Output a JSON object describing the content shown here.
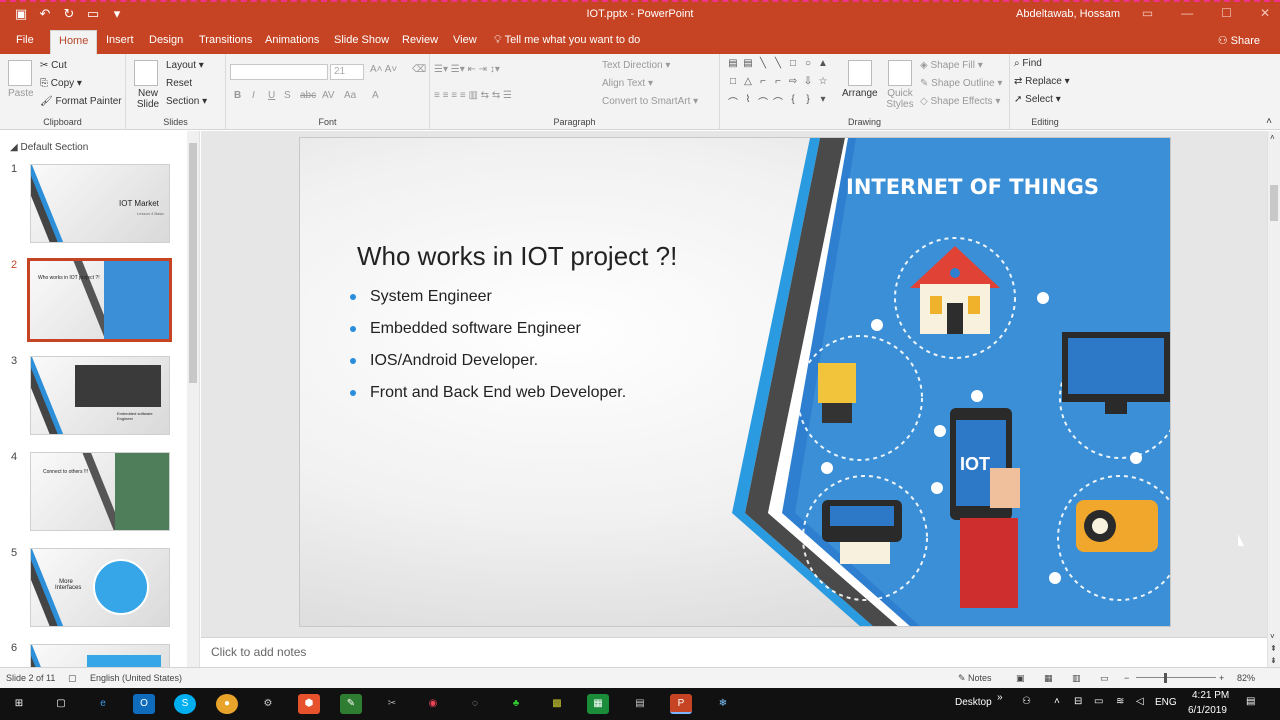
{
  "window": {
    "title": "IOT.pptx  -  PowerPoint",
    "user": "Abdeltawab, Hossam",
    "qat": [
      "save-icon",
      "undo-icon",
      "redo-icon",
      "start-from-beginning-icon",
      "customize-icon"
    ]
  },
  "tabs": [
    "File",
    "Home",
    "Insert",
    "Design",
    "Transitions",
    "Animations",
    "Slide Show",
    "Review",
    "View"
  ],
  "active_tab": "Home",
  "tell_me": "Tell me what you want to do",
  "share": "Share",
  "ribbon": {
    "clipboard": {
      "paste": "Paste",
      "cut": "Cut",
      "copy": "Copy",
      "format_painter": "Format Painter",
      "label": "Clipboard"
    },
    "slides": {
      "new_slide": "New Slide",
      "layout": "Layout",
      "reset": "Reset",
      "section": "Section",
      "label": "Slides"
    },
    "font": {
      "size": "21",
      "label": "Font",
      "buttons": [
        "B",
        "I",
        "U",
        "S",
        "abc",
        "AV",
        "Aa",
        "A"
      ]
    },
    "paragraph": {
      "text_direction": "Text Direction",
      "align_text": "Align Text",
      "convert_smartart": "Convert to SmartArt",
      "label": "Paragraph"
    },
    "drawing": {
      "arrange": "Arrange",
      "quick_styles": "Quick Styles",
      "shape_fill": "Shape Fill",
      "shape_outline": "Shape Outline",
      "shape_effects": "Shape Effects",
      "label": "Drawing"
    },
    "editing": {
      "find": "Find",
      "replace": "Replace",
      "select": "Select",
      "label": "Editing"
    }
  },
  "thumbnails": {
    "section": "Default Section",
    "items": [
      {
        "num": "1",
        "title": "IOT Market",
        "subtitle": "Lesson 4 Basic"
      },
      {
        "num": "2",
        "title": "Who works in IOT project ?!"
      },
      {
        "num": "3",
        "title": "Embedded software Engineer"
      },
      {
        "num": "4",
        "title": "Connect to others !!!"
      },
      {
        "num": "5",
        "title": "More Interfaces"
      },
      {
        "num": "6",
        "title": ""
      }
    ]
  },
  "slide": {
    "heading": "Who works in IOT project ?!",
    "bullets": [
      "System Engineer",
      "Embedded software Engineer",
      "IOS/Android Developer.",
      "Front and Back End web Developer."
    ],
    "image_title": "INTERNET OF THINGS",
    "phone_label": "IOT"
  },
  "notes_placeholder": "Click to add notes",
  "status": {
    "slide_of": "Slide 2 of 11",
    "language": "English (United States)",
    "notes": "Notes",
    "zoom": "82%"
  },
  "taskbar": {
    "desktop": "Desktop",
    "lang": "ENG",
    "time": "4:21 PM",
    "date": "6/1/2019"
  },
  "colors": {
    "accent": "#c64424",
    "slide_blue": "#3a8fd6",
    "bullet": "#2a8ddb"
  }
}
